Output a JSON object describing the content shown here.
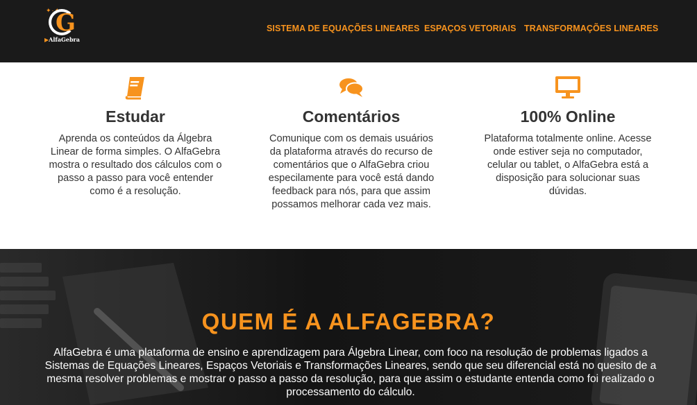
{
  "brand": {
    "name": "AlfaGebra",
    "letter": "G",
    "accent_color": "#f7931e",
    "header_bg": "#1a1a1a"
  },
  "nav": {
    "items": [
      {
        "label": "SISTEMA DE EQUAÇÕES LINEARES"
      },
      {
        "label": "ESPAÇOS VETORIAIS"
      },
      {
        "label": "TRANSFORMAÇÕES LINEARES"
      }
    ]
  },
  "features": [
    {
      "icon": "book-icon",
      "title": "Estudar",
      "text": "Aprenda os conteúdos da Álgebra Linear de forma simples. O AlfaGebra mostra o resultado dos cálculos com o passo a passo para você entender como é a resolução."
    },
    {
      "icon": "comments-icon",
      "title": "Comentários",
      "text": "Comunique com os demais usuários da plataforma através do recurso de comentários que o AlfaGebra criou especilamente para você está dando feedback para nós, para que assim possamos melhorar cada vez mais."
    },
    {
      "icon": "monitor-icon",
      "title": "100% Online",
      "text": "Plataforma totalmente online. Acesse onde estiver seja no computador, celular ou tablet, o AlfaGebra está a disposição para solucionar suas dúvidas."
    }
  ],
  "about": {
    "title": "QUEM É A ALFAGEBRA?",
    "text": "AlfaGebra é uma plataforma de ensino e aprendizagem para Álgebra Linear, com foco na resolução de problemas ligados a Sistemas de Equações Lineares, Espaços Vetoriais e Transformações Lineares, sendo que seu diferencial está no quesito de a mesma resolver problemas e mostrar o passo a passo da resolução, para que assim o estudante entenda como foi realizado o processamento do cálculo."
  }
}
